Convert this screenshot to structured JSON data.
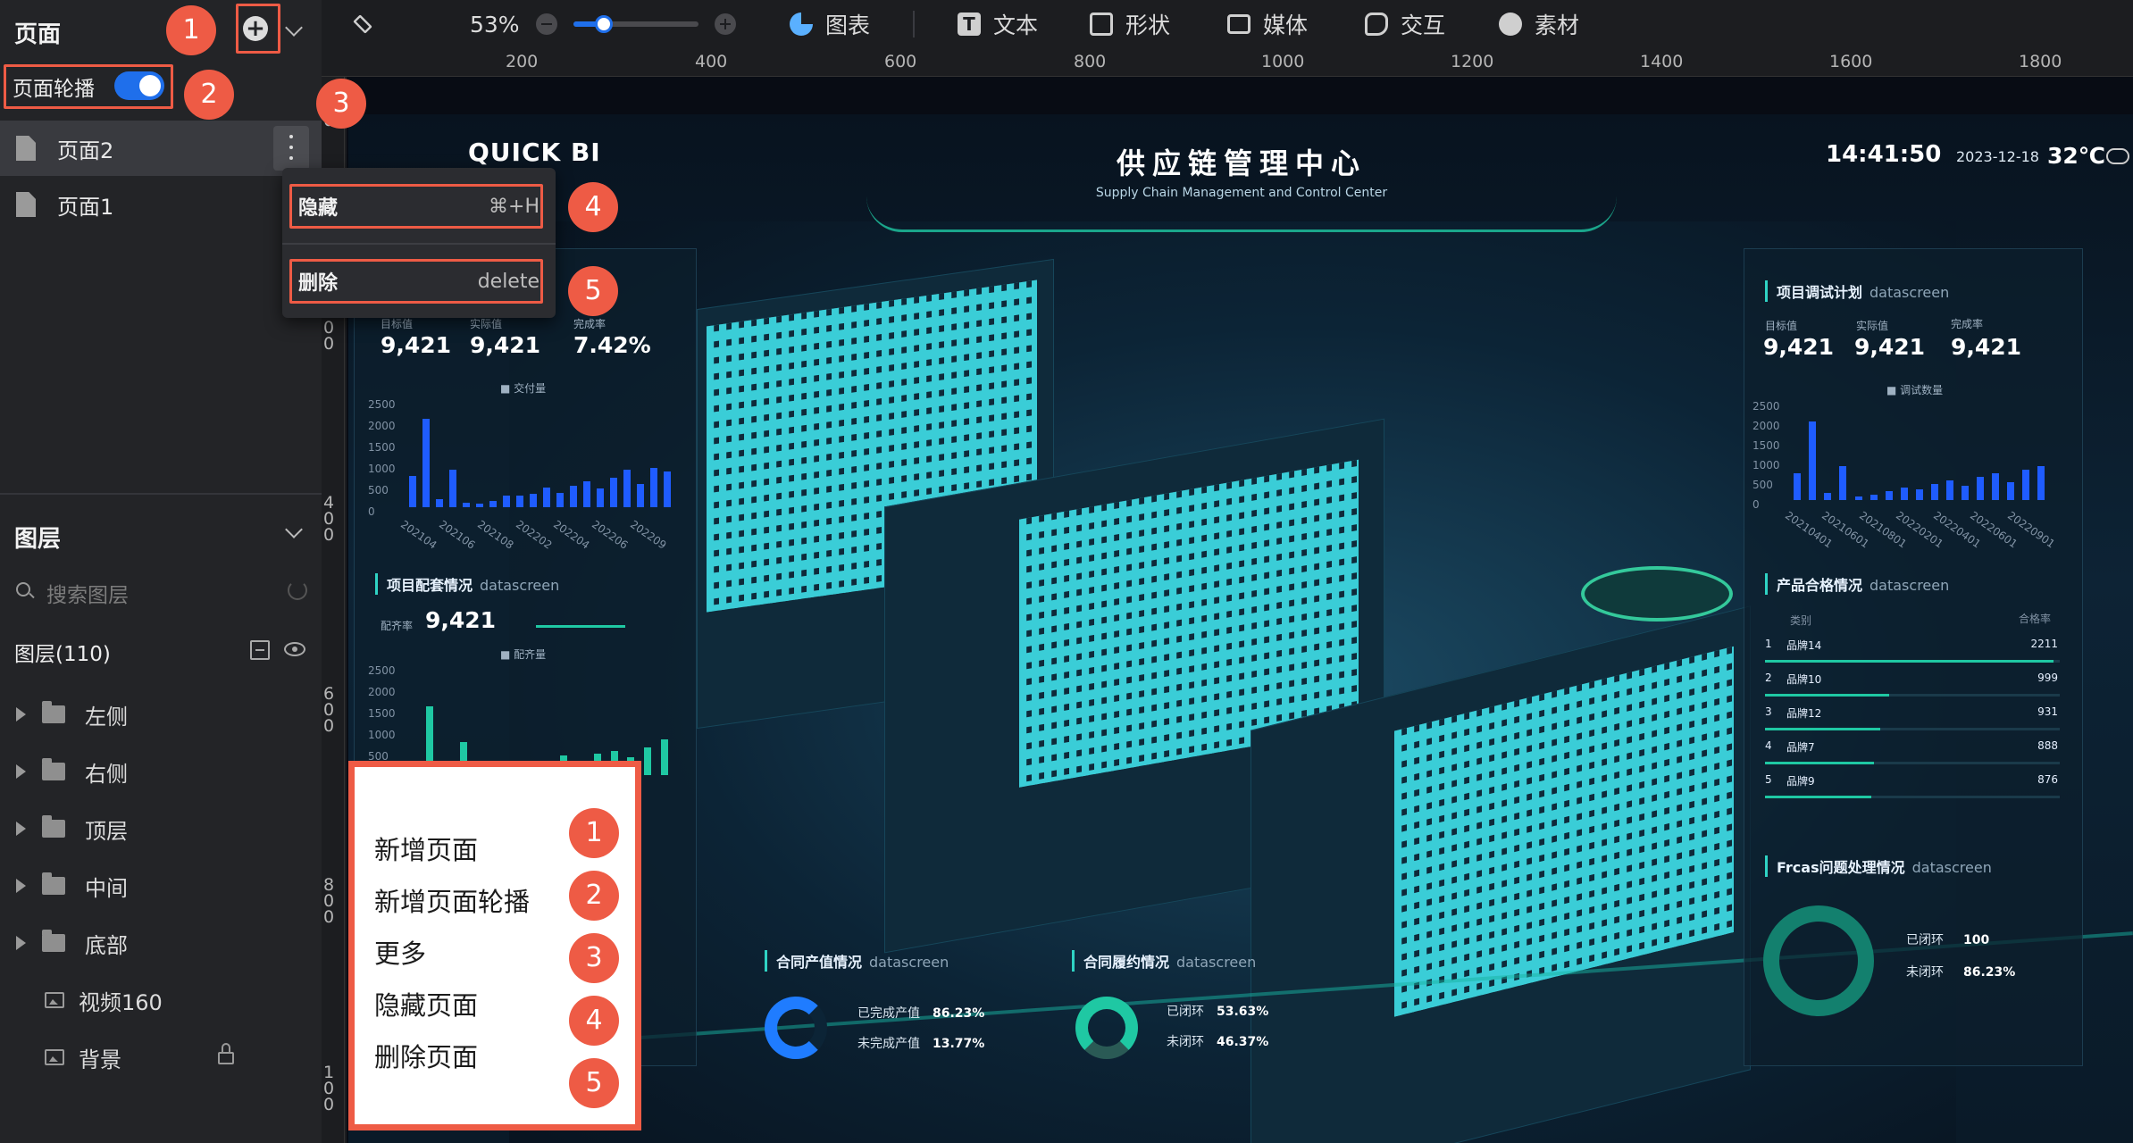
{
  "pages_panel": {
    "title": "页面",
    "carousel_label": "页面轮播",
    "pages": [
      "页面2",
      "页面1"
    ]
  },
  "context_menu": {
    "hide_label": "隐藏",
    "hide_shortcut": "⌘+H",
    "delete_label": "删除",
    "delete_shortcut": "delete"
  },
  "layers_panel": {
    "title": "图层",
    "search_placeholder": "搜索图层",
    "count_label": "图层(110)",
    "items": [
      {
        "label": "左侧",
        "type": "folder"
      },
      {
        "label": "右侧",
        "type": "folder"
      },
      {
        "label": "顶层",
        "type": "folder"
      },
      {
        "label": "中间",
        "type": "folder"
      },
      {
        "label": "底部",
        "type": "folder"
      },
      {
        "label": "视频160",
        "type": "media"
      },
      {
        "label": "背景",
        "type": "media"
      }
    ]
  },
  "toolbar": {
    "zoom": "53%",
    "zoom_level": 0.3,
    "chart": "图表",
    "text": "文本",
    "shape": "形状",
    "media": "媒体",
    "interaction": "交互",
    "assets": "素材"
  },
  "ruler": {
    "h": [
      "200",
      "400",
      "600",
      "800",
      "1000",
      "1200",
      "1400",
      "1600",
      "1800"
    ],
    "v": [
      "0",
      "2\n0\n0",
      "4\n0\n0",
      "6\n0\n0",
      "8\n0\n0",
      "1\n0\n0"
    ]
  },
  "callouts": [
    "1",
    "2",
    "3",
    "4",
    "5"
  ],
  "legend": {
    "items": [
      "新增页面",
      "新增页面轮播",
      "更多",
      "隐藏页面",
      "删除页面"
    ]
  },
  "dashboard": {
    "brand": "QUICK BI",
    "title": "供应链管理中心",
    "subtitle": "Supply Chain Management and Control Center",
    "time": "14:41:50",
    "date": "2023-12-18",
    "temperature": "32℃",
    "left_kpi_labels": [
      "目标值",
      "实际值",
      "完成率"
    ],
    "left_kpi_values": [
      "9,421",
      "9,421",
      "7.42%"
    ],
    "left_legend": "交付量",
    "left_chart_x": [
      "202104",
      "202106",
      "202108",
      "202202",
      "202204",
      "202206",
      "202209"
    ],
    "match_title": "项目配套情况",
    "datascreen": "datascreen",
    "match_rate_label": "配齐率",
    "match_rate_value": "9,421",
    "match_legend": "配齐量",
    "y_ticks": [
      "2500",
      "2000",
      "1500",
      "1000",
      "500",
      "0"
    ],
    "right_title": "项目调试计划",
    "right_kpi_labels": [
      "目标值",
      "实际值",
      "完成率"
    ],
    "right_kpi_values": [
      "9,421",
      "9,421",
      "9,421"
    ],
    "right_legend": "调试数量",
    "right_chart_x": [
      "20210401",
      "20210601",
      "20210801",
      "20220201",
      "20220401",
      "20220601",
      "20220901"
    ],
    "quality_title": "产品合格情况",
    "quality_header_cat": "类别",
    "quality_header_rate": "合格率",
    "quality_rows": [
      {
        "rank": "1",
        "name": "品牌14",
        "value": "2211",
        "pct": 0.98
      },
      {
        "rank": "2",
        "name": "品牌10",
        "value": "999",
        "pct": 0.42
      },
      {
        "rank": "3",
        "name": "品牌12",
        "value": "931",
        "pct": 0.39
      },
      {
        "rank": "4",
        "name": "品牌7",
        "value": "888",
        "pct": 0.37
      },
      {
        "rank": "5",
        "name": "品牌9",
        "value": "876",
        "pct": 0.36
      }
    ],
    "frcas_title": "Frcas问题处理情况",
    "frcas_items": [
      {
        "label": "已闭环",
        "value": "100"
      },
      {
        "label": "未闭环",
        "value": "86.23%"
      }
    ],
    "contract_title": "合同产值情况",
    "contract_items": [
      {
        "label": "已完成产值",
        "value": "86.23%"
      },
      {
        "label": "未完成产值",
        "value": "13.77%"
      }
    ],
    "perform_title": "合同履约情况",
    "perform_items": [
      {
        "label": "已闭环",
        "value": "53.63%"
      },
      {
        "label": "未闭环",
        "value": "46.37%"
      }
    ],
    "left_bars": [
      0.32,
      0.9,
      0.08,
      0.38,
      0.05,
      0.04,
      0.06,
      0.12,
      0.12,
      0.14,
      0.2,
      0.15,
      0.22,
      0.26,
      0.19,
      0.3,
      0.38,
      0.24,
      0.4,
      0.36
    ],
    "match_bars": [
      0.14,
      0.7,
      0.05,
      0.34,
      0.12,
      0.05,
      0.1,
      0.12,
      0.14,
      0.2,
      0.15,
      0.22,
      0.25,
      0.18,
      0.28,
      0.36
    ],
    "right_bars": [
      0.3,
      0.88,
      0.08,
      0.38,
      0.04,
      0.06,
      0.1,
      0.14,
      0.12,
      0.18,
      0.22,
      0.16,
      0.26,
      0.3,
      0.2,
      0.34,
      0.38
    ]
  },
  "colors": {
    "accent_red": "#ee5b45",
    "toggle_blue": "#1f6feb",
    "teal": "#1fc8a3",
    "bar_blue": "#1f5cff"
  }
}
